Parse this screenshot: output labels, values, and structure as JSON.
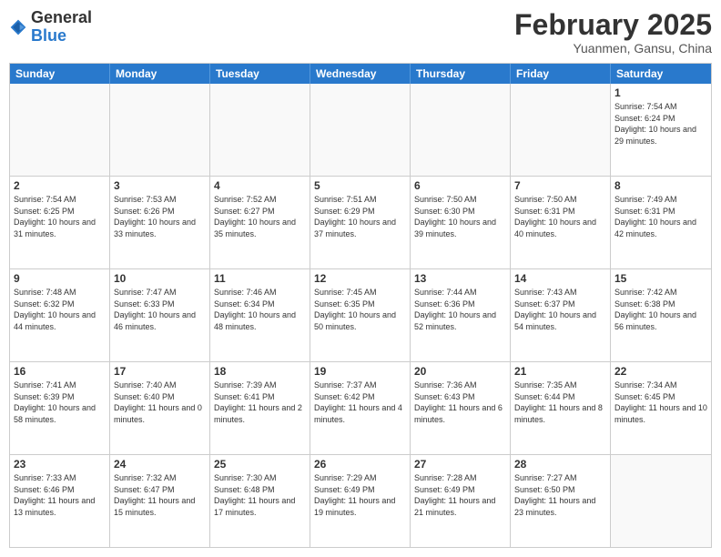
{
  "header": {
    "logo": {
      "general": "General",
      "blue": "Blue"
    },
    "title": "February 2025",
    "subtitle": "Yuanmen, Gansu, China"
  },
  "calendar": {
    "days": [
      "Sunday",
      "Monday",
      "Tuesday",
      "Wednesday",
      "Thursday",
      "Friday",
      "Saturday"
    ],
    "rows": [
      [
        {
          "day": "",
          "text": ""
        },
        {
          "day": "",
          "text": ""
        },
        {
          "day": "",
          "text": ""
        },
        {
          "day": "",
          "text": ""
        },
        {
          "day": "",
          "text": ""
        },
        {
          "day": "",
          "text": ""
        },
        {
          "day": "1",
          "text": "Sunrise: 7:54 AM\nSunset: 6:24 PM\nDaylight: 10 hours and 29 minutes."
        }
      ],
      [
        {
          "day": "2",
          "text": "Sunrise: 7:54 AM\nSunset: 6:25 PM\nDaylight: 10 hours and 31 minutes."
        },
        {
          "day": "3",
          "text": "Sunrise: 7:53 AM\nSunset: 6:26 PM\nDaylight: 10 hours and 33 minutes."
        },
        {
          "day": "4",
          "text": "Sunrise: 7:52 AM\nSunset: 6:27 PM\nDaylight: 10 hours and 35 minutes."
        },
        {
          "day": "5",
          "text": "Sunrise: 7:51 AM\nSunset: 6:29 PM\nDaylight: 10 hours and 37 minutes."
        },
        {
          "day": "6",
          "text": "Sunrise: 7:50 AM\nSunset: 6:30 PM\nDaylight: 10 hours and 39 minutes."
        },
        {
          "day": "7",
          "text": "Sunrise: 7:50 AM\nSunset: 6:31 PM\nDaylight: 10 hours and 40 minutes."
        },
        {
          "day": "8",
          "text": "Sunrise: 7:49 AM\nSunset: 6:31 PM\nDaylight: 10 hours and 42 minutes."
        }
      ],
      [
        {
          "day": "9",
          "text": "Sunrise: 7:48 AM\nSunset: 6:32 PM\nDaylight: 10 hours and 44 minutes."
        },
        {
          "day": "10",
          "text": "Sunrise: 7:47 AM\nSunset: 6:33 PM\nDaylight: 10 hours and 46 minutes."
        },
        {
          "day": "11",
          "text": "Sunrise: 7:46 AM\nSunset: 6:34 PM\nDaylight: 10 hours and 48 minutes."
        },
        {
          "day": "12",
          "text": "Sunrise: 7:45 AM\nSunset: 6:35 PM\nDaylight: 10 hours and 50 minutes."
        },
        {
          "day": "13",
          "text": "Sunrise: 7:44 AM\nSunset: 6:36 PM\nDaylight: 10 hours and 52 minutes."
        },
        {
          "day": "14",
          "text": "Sunrise: 7:43 AM\nSunset: 6:37 PM\nDaylight: 10 hours and 54 minutes."
        },
        {
          "day": "15",
          "text": "Sunrise: 7:42 AM\nSunset: 6:38 PM\nDaylight: 10 hours and 56 minutes."
        }
      ],
      [
        {
          "day": "16",
          "text": "Sunrise: 7:41 AM\nSunset: 6:39 PM\nDaylight: 10 hours and 58 minutes."
        },
        {
          "day": "17",
          "text": "Sunrise: 7:40 AM\nSunset: 6:40 PM\nDaylight: 11 hours and 0 minutes."
        },
        {
          "day": "18",
          "text": "Sunrise: 7:39 AM\nSunset: 6:41 PM\nDaylight: 11 hours and 2 minutes."
        },
        {
          "day": "19",
          "text": "Sunrise: 7:37 AM\nSunset: 6:42 PM\nDaylight: 11 hours and 4 minutes."
        },
        {
          "day": "20",
          "text": "Sunrise: 7:36 AM\nSunset: 6:43 PM\nDaylight: 11 hours and 6 minutes."
        },
        {
          "day": "21",
          "text": "Sunrise: 7:35 AM\nSunset: 6:44 PM\nDaylight: 11 hours and 8 minutes."
        },
        {
          "day": "22",
          "text": "Sunrise: 7:34 AM\nSunset: 6:45 PM\nDaylight: 11 hours and 10 minutes."
        }
      ],
      [
        {
          "day": "23",
          "text": "Sunrise: 7:33 AM\nSunset: 6:46 PM\nDaylight: 11 hours and 13 minutes."
        },
        {
          "day": "24",
          "text": "Sunrise: 7:32 AM\nSunset: 6:47 PM\nDaylight: 11 hours and 15 minutes."
        },
        {
          "day": "25",
          "text": "Sunrise: 7:30 AM\nSunset: 6:48 PM\nDaylight: 11 hours and 17 minutes."
        },
        {
          "day": "26",
          "text": "Sunrise: 7:29 AM\nSunset: 6:49 PM\nDaylight: 11 hours and 19 minutes."
        },
        {
          "day": "27",
          "text": "Sunrise: 7:28 AM\nSunset: 6:49 PM\nDaylight: 11 hours and 21 minutes."
        },
        {
          "day": "28",
          "text": "Sunrise: 7:27 AM\nSunset: 6:50 PM\nDaylight: 11 hours and 23 minutes."
        },
        {
          "day": "",
          "text": ""
        }
      ]
    ]
  }
}
